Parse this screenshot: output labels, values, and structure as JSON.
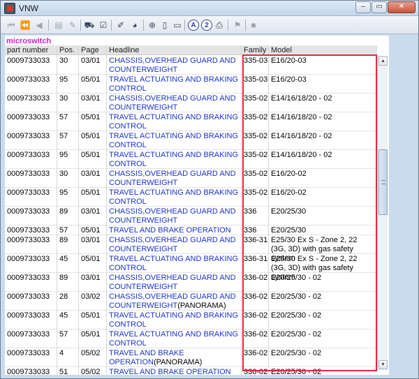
{
  "window": {
    "title": "VNW",
    "min_label": "–",
    "max_label": "▭",
    "close_label": "✕"
  },
  "toolbar": {
    "icons": [
      "first-page-icon",
      "prev-fast-icon",
      "prev-icon",
      "book-icon",
      "edit-icon",
      "cart-icon",
      "checklist-icon",
      "eraser-icon",
      "chart-icon",
      "zoom-icon",
      "page-icon",
      "pages-icon",
      "a-circle-icon",
      "two-circle-icon",
      "print-icon",
      "bookmark-icon",
      "stop-icon"
    ],
    "a_label": "A",
    "two_label": "2"
  },
  "section_title": "microswitch",
  "columns": {
    "part": "part number",
    "pos": "Pos.",
    "page": "Page",
    "headline": "Headline",
    "family": "Family",
    "model": "Model"
  },
  "rows": [
    {
      "part": "0009733033",
      "pos": "30",
      "page": "03/01",
      "headline": "CHASSIS,OVERHEAD GUARD AND COUNTERWEIGHT",
      "extra": "",
      "family": "335-03",
      "model": "E16/20-03"
    },
    {
      "part": "0009733033",
      "pos": "95",
      "page": "05/01",
      "headline": "TRAVEL ACTUATING AND BRAKING CONTROL",
      "extra": "",
      "family": "335-03",
      "model": "E16/20-03"
    },
    {
      "part": "0009733033",
      "pos": "30",
      "page": "03/01",
      "headline": "CHASSIS,OVERHEAD GUARD AND COUNTERWEIGHT",
      "extra": "",
      "family": "335-02",
      "model": "E14/16/18/20 - 02"
    },
    {
      "part": "0009733033",
      "pos": "57",
      "page": "05/01",
      "headline": "TRAVEL ACTUATING AND BRAKING CONTROL",
      "extra": "",
      "family": "335-02",
      "model": "E14/16/18/20 - 02"
    },
    {
      "part": "0009733033",
      "pos": "57",
      "page": "05/01",
      "headline": "TRAVEL ACTUATING AND BRAKING CONTROL",
      "extra": "",
      "family": "335-02",
      "model": "E14/16/18/20 - 02"
    },
    {
      "part": "0009733033",
      "pos": "95",
      "page": "05/01",
      "headline": "TRAVEL ACTUATING AND BRAKING CONTROL",
      "extra": "",
      "family": "335-02",
      "model": "E14/16/18/20 - 02"
    },
    {
      "part": "0009733033",
      "pos": "30",
      "page": "03/01",
      "headline": "CHASSIS,OVERHEAD GUARD AND COUNTERWEIGHT",
      "extra": "",
      "family": "335-02",
      "model": "E16/20-02"
    },
    {
      "part": "0009733033",
      "pos": "95",
      "page": "05/01",
      "headline": "TRAVEL ACTUATING AND BRAKING CONTROL",
      "extra": "",
      "family": "335-02",
      "model": "E16/20-02"
    },
    {
      "part": "0009733033",
      "pos": "89",
      "page": "03/01",
      "headline": "CHASSIS,OVERHEAD GUARD AND COUNTERWEIGHT",
      "extra": "",
      "family": "336",
      "model": "E20/25/30"
    },
    {
      "part": "0009733033",
      "pos": "57",
      "page": "05/01",
      "headline": "TRAVEL AND BRAKE OPERATION",
      "extra": "",
      "family": "336",
      "model": "E20/25/30"
    },
    {
      "part": "0009733033",
      "pos": "89",
      "page": "03/01",
      "headline": "CHASSIS,OVERHEAD GUARD AND COUNTERWEIGHT",
      "extra": "",
      "family": "336-31",
      "model": "E25/30 Ex S - Zone 2, 22 (3G, 3D) with gas safety system"
    },
    {
      "part": "0009733033",
      "pos": "45",
      "page": "05/01",
      "headline": "TRAVEL ACTUATING AND BRAKING CONTROL",
      "extra": "",
      "family": "336-31",
      "model": "E25/30 Ex S - Zone 2, 22 (3G, 3D) with gas safety system"
    },
    {
      "part": "0009733033",
      "pos": "89",
      "page": "03/01",
      "headline": "CHASSIS,OVERHEAD GUARD AND COUNTERWEIGHT",
      "extra": "",
      "family": "336-02",
      "model": "E20/25/30 - 02"
    },
    {
      "part": "0009733033",
      "pos": "28",
      "page": "03/02",
      "headline": "CHASSIS,OVERHEAD GUARD AND COUNTERWEIGHT",
      "extra": "(PANORAMA)",
      "family": "336-02",
      "model": "E20/25/30 - 02"
    },
    {
      "part": "0009733033",
      "pos": "45",
      "page": "05/01",
      "headline": "TRAVEL ACTUATING AND BRAKING CONTROL",
      "extra": "",
      "family": "336-02",
      "model": "E20/25/30 - 02"
    },
    {
      "part": "0009733033",
      "pos": "57",
      "page": "05/01",
      "headline": "TRAVEL ACTUATING AND BRAKING CONTROL",
      "extra": "",
      "family": "336-02",
      "model": "E20/25/30 - 02"
    },
    {
      "part": "0009733033",
      "pos": "4",
      "page": "05/02",
      "headline": "TRAVEL AND BRAKE OPERATION",
      "extra": "(PANORAMA)",
      "family": "336-02",
      "model": "E20/25/30 - 02"
    },
    {
      "part": "0009733033",
      "pos": "51",
      "page": "05/02",
      "headline": "TRAVEL AND BRAKE OPERATION",
      "extra": "",
      "family": "336-02",
      "model": "E20/25/30 - 02"
    }
  ],
  "colors": {
    "headline_link": "#1a32c9",
    "section_title": "#d11fcf",
    "highlight_border": "#e32a3a"
  }
}
